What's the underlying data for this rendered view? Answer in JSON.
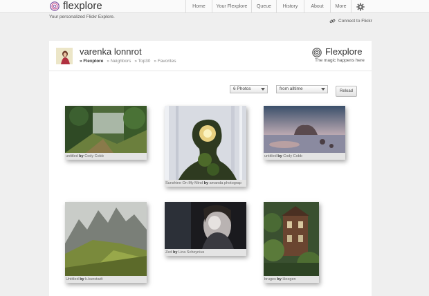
{
  "app": {
    "name": "flexplore",
    "tagline": "Your personalized Flickr Explore."
  },
  "nav": {
    "items": [
      "Home",
      "Your Flexplore",
      "Queue",
      "History",
      "About",
      "More"
    ]
  },
  "connect_label": "Connect to Flickr",
  "profile": {
    "username": "varenka lonnrot",
    "subnav": [
      "» Flexplore",
      "» Neighbors",
      "» Top30",
      "» Favorites"
    ]
  },
  "brand": {
    "name": "Flexplore",
    "subtitle": "The magic happens here"
  },
  "controls": {
    "photo_count": "6 Photos",
    "time_range": "from alltime",
    "reload_label": "Reload"
  },
  "photos": [
    {
      "title": "untitled",
      "by": "by",
      "author": "Cody Cobb"
    },
    {
      "title": "Sunshine On My Mind",
      "by": "by",
      "author": "amanda photograp"
    },
    {
      "title": "untitled",
      "by": "by",
      "author": "Cody Cobb"
    },
    {
      "title": "Untitled",
      "by": "by",
      "author": "k.kunstadt"
    },
    {
      "title": "Zed",
      "by": "by",
      "author": "Lina Scheynius"
    },
    {
      "title": "bruges",
      "by": "by",
      "author": "Heegen"
    }
  ],
  "colors": {
    "accent": "#7a4a9e",
    "background": "#efefef",
    "panel": "#ffffff"
  }
}
